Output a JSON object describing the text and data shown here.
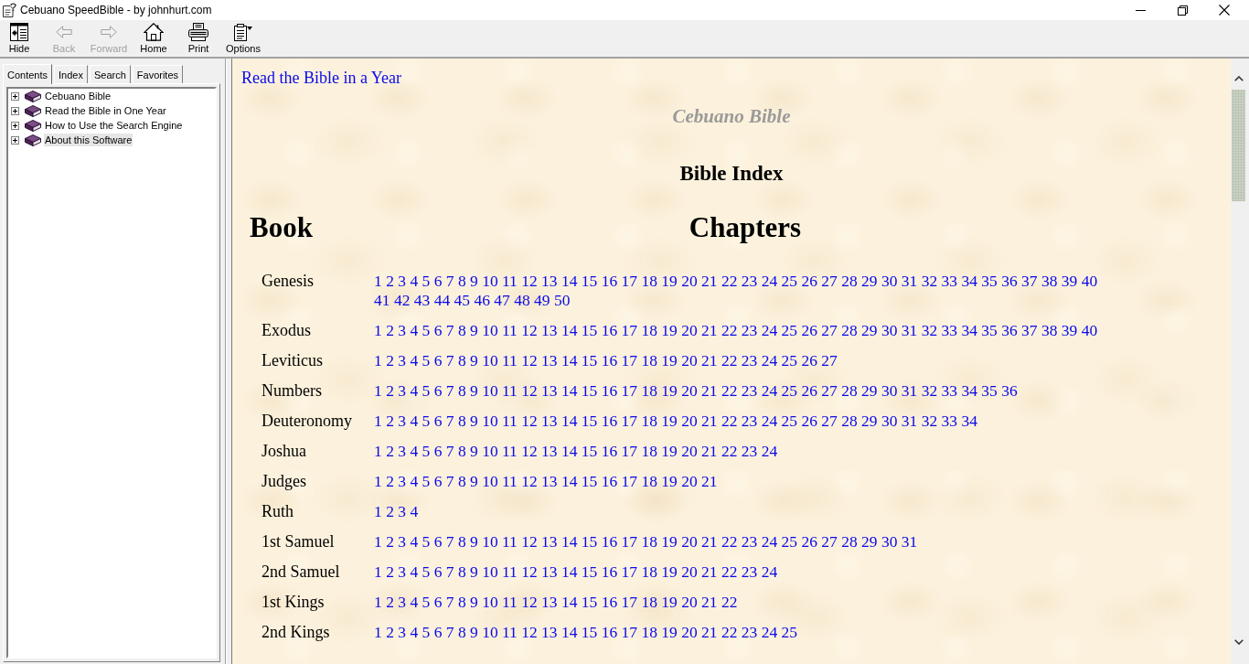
{
  "window": {
    "title": "Cebuano SpeedBible - by johnhurt.com"
  },
  "toolbar": [
    {
      "kind": "hide",
      "label": "Hide",
      "disabled": false
    },
    {
      "kind": "back",
      "label": "Back",
      "disabled": true
    },
    {
      "kind": "forward",
      "label": "Forward",
      "disabled": true
    },
    {
      "kind": "home",
      "label": "Home",
      "disabled": false
    },
    {
      "kind": "print",
      "label": "Print",
      "disabled": false
    },
    {
      "kind": "options",
      "label": "Options",
      "disabled": false
    }
  ],
  "navigation_tabs": [
    {
      "label": "Contents",
      "selected": true
    },
    {
      "label": "Index",
      "selected": false
    },
    {
      "label": "Search",
      "selected": false
    },
    {
      "label": "Favorites",
      "selected": false
    }
  ],
  "contents_tree": [
    {
      "label": "Cebuano Bible",
      "expanded": false,
      "selected": false
    },
    {
      "label": "Read the Bible in One Year",
      "expanded": false,
      "selected": false
    },
    {
      "label": "How to Use the Search Engine",
      "expanded": false,
      "selected": false
    },
    {
      "label": "About this Software",
      "expanded": false,
      "selected": true
    }
  ],
  "page": {
    "top_link": "Read the Bible in a Year",
    "subtitle": "Cebuano Bible",
    "heading": "Bible Index",
    "table": {
      "columns": [
        "Book",
        "Chapters"
      ],
      "rows": [
        {
          "book": "Genesis",
          "chapters": [
            "1",
            "2",
            "3",
            "4",
            "5",
            "6",
            "7",
            "8",
            "9",
            "10",
            "11",
            "12",
            "13",
            "14",
            "15",
            "16",
            "17",
            "18",
            "19",
            "20",
            "21",
            "22",
            "23",
            "24",
            "25",
            "26",
            "27",
            "28",
            "29",
            "30",
            "31",
            "32",
            "33",
            "34",
            "35",
            "36",
            "37",
            "38",
            "39",
            "40",
            "41",
            "42",
            "43",
            "44",
            "45",
            "46",
            "47",
            "48",
            "49",
            "50"
          ]
        },
        {
          "book": "Exodus",
          "chapters": [
            "1",
            "2",
            "3",
            "4",
            "5",
            "6",
            "7",
            "8",
            "9",
            "10",
            "11",
            "12",
            "13",
            "14",
            "15",
            "16",
            "17",
            "18",
            "19",
            "20",
            "21",
            "22",
            "23",
            "24",
            "25",
            "26",
            "27",
            "28",
            "29",
            "30",
            "31",
            "32",
            "33",
            "34",
            "35",
            "36",
            "37",
            "38",
            "39",
            "40"
          ]
        },
        {
          "book": "Leviticus",
          "chapters": [
            "1",
            "2",
            "3",
            "4",
            "5",
            "6",
            "7",
            "8",
            "9",
            "10",
            "11",
            "12",
            "13",
            "14",
            "15",
            "16",
            "17",
            "18",
            "19",
            "20",
            "21",
            "22",
            "23",
            "24",
            "25",
            "26",
            "27"
          ]
        },
        {
          "book": "Numbers",
          "chapters": [
            "1",
            "2",
            "3",
            "4",
            "5",
            "6",
            "7",
            "8",
            "9",
            "10",
            "11",
            "12",
            "13",
            "14",
            "15",
            "16",
            "17",
            "18",
            "19",
            "20",
            "21",
            "22",
            "23",
            "24",
            "25",
            "26",
            "27",
            "28",
            "29",
            "30",
            "31",
            "32",
            "33",
            "34",
            "35",
            "36"
          ]
        },
        {
          "book": "Deuteronomy",
          "chapters": [
            "1",
            "2",
            "3",
            "4",
            "5",
            "6",
            "7",
            "8",
            "9",
            "10",
            "11",
            "12",
            "13",
            "14",
            "15",
            "16",
            "17",
            "18",
            "19",
            "20",
            "21",
            "22",
            "23",
            "24",
            "25",
            "26",
            "27",
            "28",
            "29",
            "30",
            "31",
            "32",
            "33",
            "34"
          ]
        },
        {
          "book": "Joshua",
          "chapters": [
            "1",
            "2",
            "3",
            "4",
            "5",
            "6",
            "7",
            "8",
            "9",
            "10",
            "11",
            "12",
            "13",
            "14",
            "15",
            "16",
            "17",
            "18",
            "19",
            "20",
            "21",
            "22",
            "23",
            "24"
          ]
        },
        {
          "book": "Judges",
          "chapters": [
            "1",
            "2",
            "3",
            "4",
            "5",
            "6",
            "7",
            "8",
            "9",
            "10",
            "11",
            "12",
            "13",
            "14",
            "15",
            "16",
            "17",
            "18",
            "19",
            "20",
            "21"
          ]
        },
        {
          "book": "Ruth",
          "chapters": [
            "1",
            "2",
            "3",
            "4"
          ]
        },
        {
          "book": "1st Samuel",
          "chapters": [
            "1",
            "2",
            "3",
            "4",
            "5",
            "6",
            "7",
            "8",
            "9",
            "10",
            "11",
            "12",
            "13",
            "14",
            "15",
            "16",
            "17",
            "18",
            "19",
            "20",
            "21",
            "22",
            "23",
            "24",
            "25",
            "26",
            "27",
            "28",
            "29",
            "30",
            "31"
          ]
        },
        {
          "book": "2nd Samuel",
          "chapters": [
            "1",
            "2",
            "3",
            "4",
            "5",
            "6",
            "7",
            "8",
            "9",
            "10",
            "11",
            "12",
            "13",
            "14",
            "15",
            "16",
            "17",
            "18",
            "19",
            "20",
            "21",
            "22",
            "23",
            "24"
          ]
        },
        {
          "book": "1st Kings",
          "chapters": [
            "1",
            "2",
            "3",
            "4",
            "5",
            "6",
            "7",
            "8",
            "9",
            "10",
            "11",
            "12",
            "13",
            "14",
            "15",
            "16",
            "17",
            "18",
            "19",
            "20",
            "21",
            "22"
          ]
        },
        {
          "book": "2nd Kings",
          "chapters": [
            "1",
            "2",
            "3",
            "4",
            "5",
            "6",
            "7",
            "8",
            "9",
            "10",
            "11",
            "12",
            "13",
            "14",
            "15",
            "16",
            "17",
            "18",
            "19",
            "20",
            "21",
            "22",
            "23",
            "24",
            "25"
          ]
        }
      ]
    }
  }
}
